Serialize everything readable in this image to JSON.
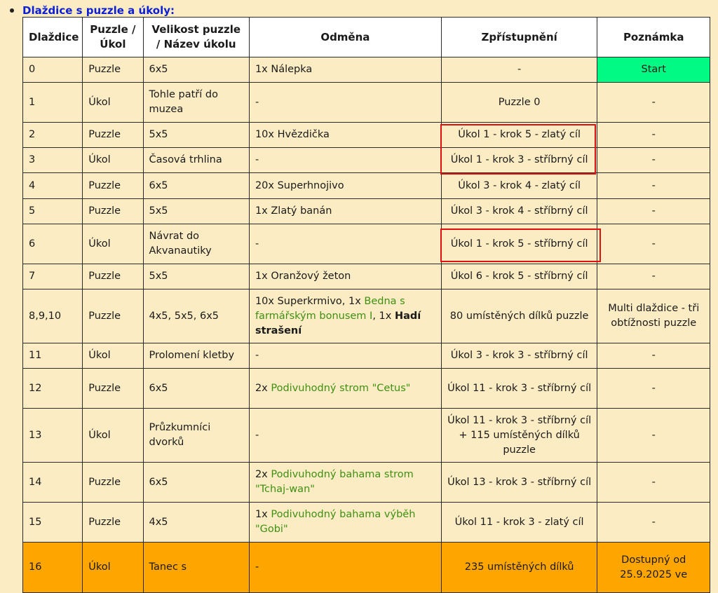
{
  "heading": "Dlaždice s puzzle a úkoly:",
  "columns": [
    "Dlaždice",
    "Puzzle / Úkol",
    "Velikost puzzle / Název úkolu",
    "Odměna",
    "Zpřístupnění",
    "Poznámka"
  ],
  "rows": [
    {
      "tile": "0",
      "type": "Puzzle",
      "name": "6x5",
      "reward": "1x Nálepka",
      "unlock": "-",
      "note": "Start"
    },
    {
      "tile": "1",
      "type": "Úkol",
      "name": "Tohle patří do muzea",
      "reward": "-",
      "unlock": "Puzzle 0",
      "note": "-"
    },
    {
      "tile": "2",
      "type": "Puzzle",
      "name": "5x5",
      "reward": "10x Hvězdička",
      "unlock": "Úkol 1 - krok 5 - zlatý cíl",
      "note": "-"
    },
    {
      "tile": "3",
      "type": "Úkol",
      "name": "Časová trhlina",
      "reward": "-",
      "unlock": "Úkol 1 - krok 3 - stříbrný cíl",
      "note": "-"
    },
    {
      "tile": "4",
      "type": "Puzzle",
      "name": "6x5",
      "reward": "20x Superhnojivo",
      "unlock": "Úkol 3 - krok 4 - zlatý cíl",
      "note": "-"
    },
    {
      "tile": "5",
      "type": "Puzzle",
      "name": "5x5",
      "reward": "1x Zlatý banán",
      "unlock": "Úkol 3 - krok 4 - stříbrný cíl",
      "note": "-"
    },
    {
      "tile": "6",
      "type": "Úkol",
      "name": "Návrat do Akvanautiky",
      "reward": "-",
      "unlock": "Úkol 1 - krok 5 - stříbrný cíl",
      "note": "-"
    },
    {
      "tile": "7",
      "type": "Puzzle",
      "name": "5x5",
      "reward": "1x Oranžový žeton",
      "unlock": "Úkol 6 - krok 5 - stříbrný cíl",
      "note": "-"
    },
    {
      "tile": "8,9,10",
      "type": "Puzzle",
      "name": "4x5, 5x5, 6x5",
      "reward": "",
      "reward_parts": [
        "10x Superkrmivo, 1x ",
        "Bedna s farmářským bonusem I",
        ", 1x ",
        "Hadí strašení"
      ],
      "unlock": "80 umístěných dílků puzzle",
      "note": "Multi dlaždice - tři obtížnosti puzzle"
    },
    {
      "tile": "11",
      "type": "Úkol",
      "name": "Prolomení kletby",
      "reward": "-",
      "unlock": "Úkol 3 - krok 3 - stříbrný cíl",
      "note": "-"
    },
    {
      "tile": "12",
      "type": "Puzzle",
      "name": "6x5",
      "reward": "",
      "reward_parts": [
        "2x ",
        "Podivuhodný strom \"Cetus\""
      ],
      "unlock": "Úkol 11 - krok 3 - stříbrný cíl",
      "note": "-"
    },
    {
      "tile": "13",
      "type": "Úkol",
      "name": "Průzkumníci dvorků",
      "reward": "-",
      "unlock": "Úkol 11 - krok 3 - stříbrný cíl + 115 umístěných dílků puzzle",
      "note": "-"
    },
    {
      "tile": "14",
      "type": "Puzzle",
      "name": "6x5",
      "reward": "",
      "reward_parts": [
        "2x ",
        "Podivuhodný bahama strom \"Tchaj-wan\""
      ],
      "unlock": "Úkol 13 - krok 3 - stříbrný cíl",
      "note": "-"
    },
    {
      "tile": "15",
      "type": "Puzzle",
      "name": "4x5",
      "reward": "",
      "reward_parts": [
        "1x ",
        "Podivuhodný bahama výběh \"Gobi\""
      ],
      "unlock": "Úkol 11 - krok 3 - zlatý cíl",
      "note": "-"
    },
    {
      "tile": "16",
      "type": "Úkol",
      "name": "Tanec s",
      "reward": "-",
      "unlock": "235 umístěných dílků",
      "note": "Dostupný od 25.9.2025 ve"
    }
  ],
  "colors": {
    "background": "#fbecc3",
    "heading": "#0b1fd6",
    "link": "#3f8f12",
    "start_cell": "#00fa84",
    "highlight_row": "#ffa500",
    "annotation_box": "#e01010"
  }
}
